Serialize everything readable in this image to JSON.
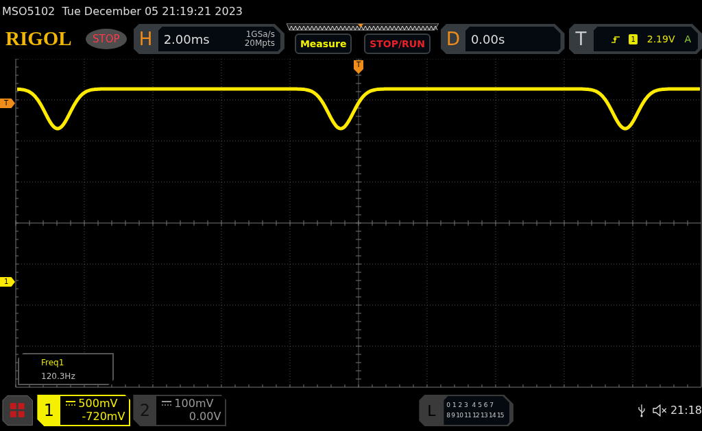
{
  "status_line": "MSO5102  Tue December 05 21:19:21 2023",
  "logo": "RIGOL",
  "run_state": "STOP",
  "horizontal": {
    "letter": "H",
    "timebase": "2.00ms",
    "sample_rate": "1GSa/s",
    "memory_depth": "20Mpts"
  },
  "buttons": [
    {
      "label": "Measure",
      "kind": "measure"
    },
    {
      "label": "STOP/RUN",
      "kind": "stoprun"
    }
  ],
  "delay": {
    "letter": "D",
    "value": "0.00s"
  },
  "trigger": {
    "letter": "T",
    "source": "1",
    "level": "2.19V",
    "mode": "A"
  },
  "markers": {
    "top_trigger": "T",
    "trigger_level": "T",
    "channel": "1"
  },
  "measurement": {
    "name": "Freq1",
    "value": "120.3Hz"
  },
  "channels": [
    {
      "number": "1",
      "scale": "500mV",
      "offset": "-720mV",
      "selected": true
    },
    {
      "number": "2",
      "scale": "100mV",
      "offset": "0.00V",
      "selected": false
    }
  ],
  "logic": {
    "letter": "L",
    "row_1": "0 1 2 3  4 5 6 7",
    "row_2": "8 9 10 11 12 13 14 15"
  },
  "clock": "21:18"
}
